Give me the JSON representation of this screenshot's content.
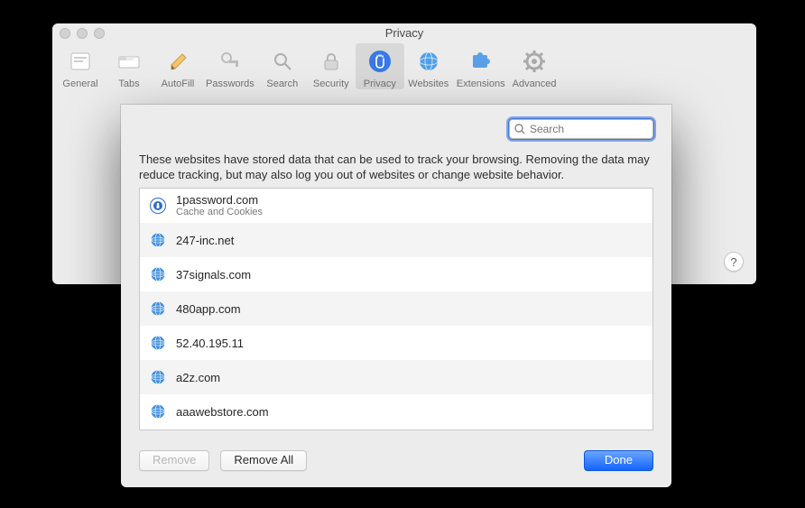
{
  "window": {
    "title": "Privacy"
  },
  "toolbar": {
    "items": [
      {
        "label": "General"
      },
      {
        "label": "Tabs"
      },
      {
        "label": "AutoFill"
      },
      {
        "label": "Passwords"
      },
      {
        "label": "Search"
      },
      {
        "label": "Security"
      },
      {
        "label": "Privacy"
      },
      {
        "label": "Websites"
      },
      {
        "label": "Extensions"
      },
      {
        "label": "Advanced"
      }
    ]
  },
  "sheet": {
    "search_placeholder": "Search",
    "description": "These websites have stored data that can be used to track your browsing. Removing the data may reduce tracking, but may also log you out of websites or change website behavior.",
    "rows": [
      {
        "domain": "1password.com",
        "sub": "Cache and Cookies",
        "icon": "1p"
      },
      {
        "domain": "247-inc.net",
        "sub": "",
        "icon": "globe"
      },
      {
        "domain": "37signals.com",
        "sub": "",
        "icon": "globe"
      },
      {
        "domain": "480app.com",
        "sub": "",
        "icon": "globe"
      },
      {
        "domain": "52.40.195.11",
        "sub": "",
        "icon": "globe"
      },
      {
        "domain": "a2z.com",
        "sub": "",
        "icon": "globe"
      },
      {
        "domain": "aaawebstore.com",
        "sub": "",
        "icon": "globe"
      }
    ],
    "buttons": {
      "remove": "Remove",
      "remove_all": "Remove All",
      "done": "Done"
    }
  },
  "help": {
    "label": "?"
  }
}
